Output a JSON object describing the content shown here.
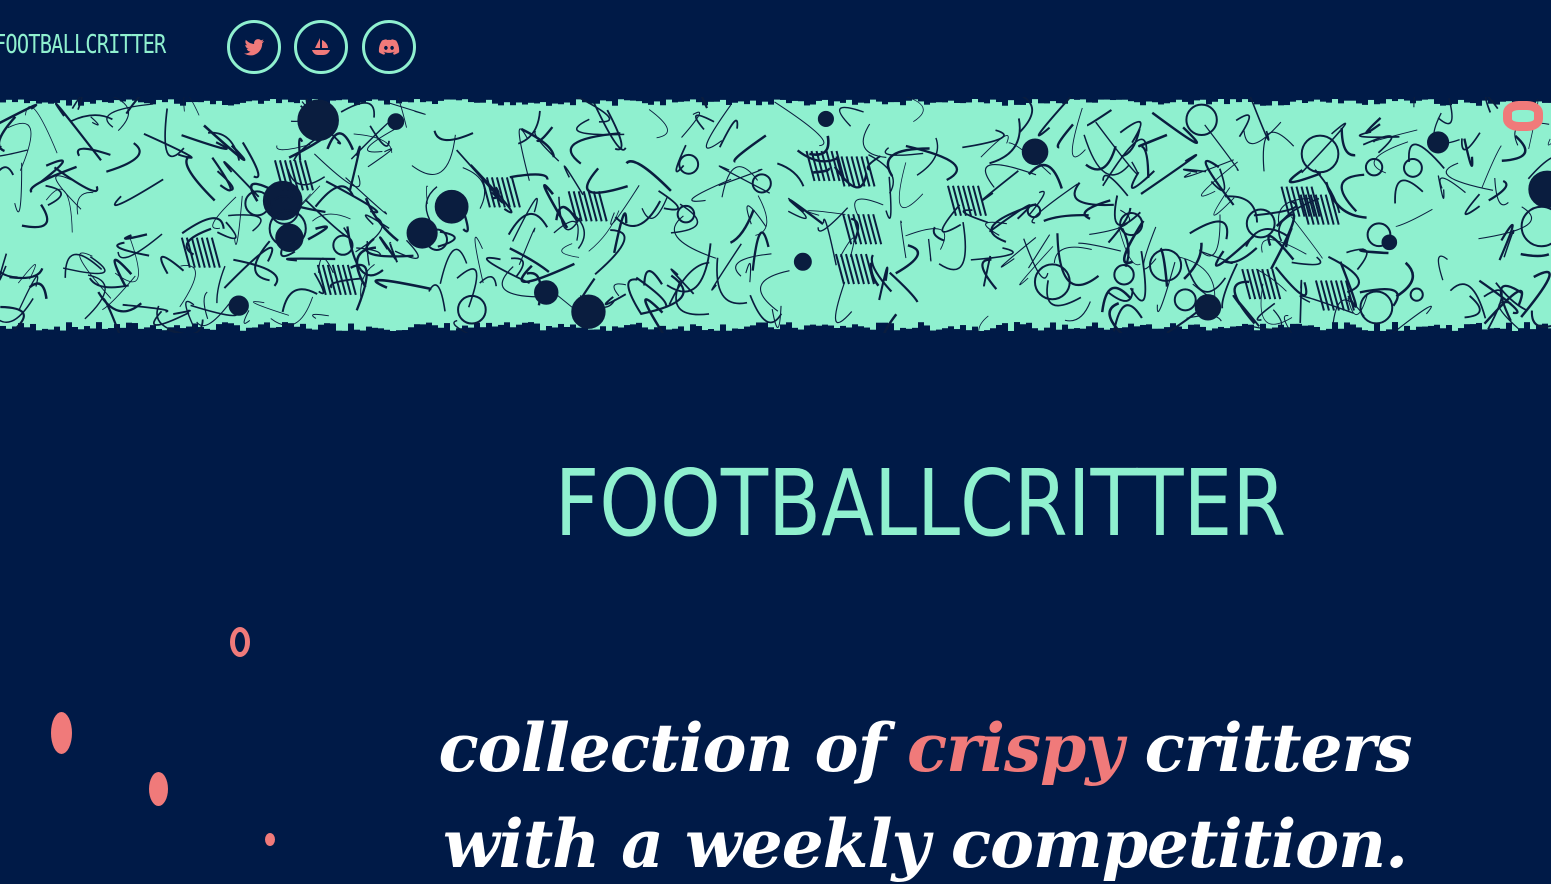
{
  "header": {
    "brand": "FOOTBALLCRITTER",
    "social": [
      {
        "name": "twitter",
        "icon": "twitter-bird-icon"
      },
      {
        "name": "opensea",
        "icon": "opensea-boat-icon"
      },
      {
        "name": "discord",
        "icon": "discord-icon"
      }
    ]
  },
  "banner": {
    "description_icon": "critter-pattern-illustration"
  },
  "hero": {
    "title": "FOOTBALLCRITTER",
    "tagline_part1": "collection of ",
    "tagline_accent": "crispy",
    "tagline_part2": " critters",
    "tagline_line2": "with a weekly competition."
  },
  "colors": {
    "background": "#001a47",
    "mint": "#8ff0cf",
    "coral": "#f07a7a",
    "white": "#ffffff"
  }
}
